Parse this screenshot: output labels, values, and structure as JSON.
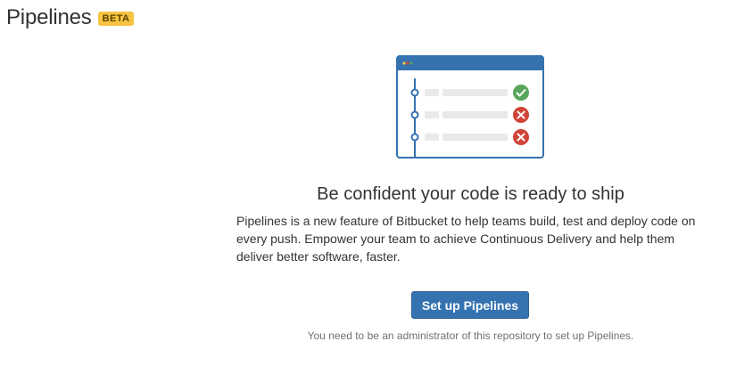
{
  "header": {
    "title": "Pipelines",
    "badge": "BETA"
  },
  "illustration": {
    "steps": [
      {
        "status": "success",
        "icon": "check-icon"
      },
      {
        "status": "failed",
        "icon": "cross-icon"
      },
      {
        "status": "failed",
        "icon": "cross-icon"
      }
    ],
    "colors": {
      "frame": "#3572b0",
      "success": "#59a65a",
      "failed": "#d04437",
      "placeholder": "#e9e9e9"
    }
  },
  "main": {
    "headline": "Be confident your code is ready to ship",
    "description": "Pipelines is a new feature of Bitbucket to help teams build, test and deploy code on every push. Empower your team to achieve Continuous Delivery and help them deliver better software, faster.",
    "button_label": "Set up Pipelines",
    "admin_note": "You need to be an administrator of this repository to set up Pipelines."
  },
  "colors": {
    "primary_button": "#3572b0",
    "beta_badge": "#f6c342"
  }
}
